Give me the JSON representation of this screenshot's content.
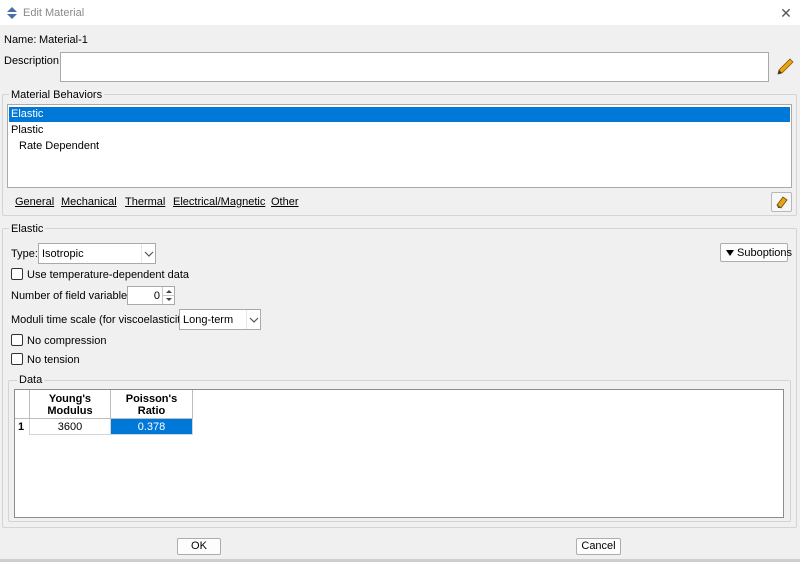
{
  "window": {
    "title": "Edit Material",
    "close": "✕"
  },
  "name": {
    "label": "Name:",
    "value": "Material-1"
  },
  "description": {
    "label": "Description:",
    "value": ""
  },
  "behaviors": {
    "title": "Material Behaviors",
    "items": [
      "Elastic",
      "Plastic",
      "Rate Dependent"
    ],
    "menu": [
      "General",
      "Mechanical",
      "Thermal",
      "Electrical/Magnetic",
      "Other"
    ]
  },
  "elastic": {
    "title": "Elastic",
    "type_label": "Type:",
    "type_value": "Isotropic",
    "suboptions": "Suboptions",
    "use_temp": "Use temperature-dependent data",
    "nfield_label": "Number of field variables:",
    "nfield_value": "0",
    "moduli_label": "Moduli time scale (for viscoelasticity):",
    "moduli_value": "Long-term",
    "no_compression": "No compression",
    "no_tension": "No tension"
  },
  "data": {
    "title": "Data",
    "columns": [
      {
        "line1": "Young's",
        "line2": "Modulus"
      },
      {
        "line1": "Poisson's",
        "line2": "Ratio"
      }
    ],
    "rows": [
      {
        "index": "1",
        "values": [
          "3600",
          "0.378"
        ]
      }
    ]
  },
  "buttons": {
    "ok": "OK",
    "cancel": "Cancel"
  },
  "colors": {
    "selection": "#0078d7",
    "pencil": "#e8a317"
  }
}
